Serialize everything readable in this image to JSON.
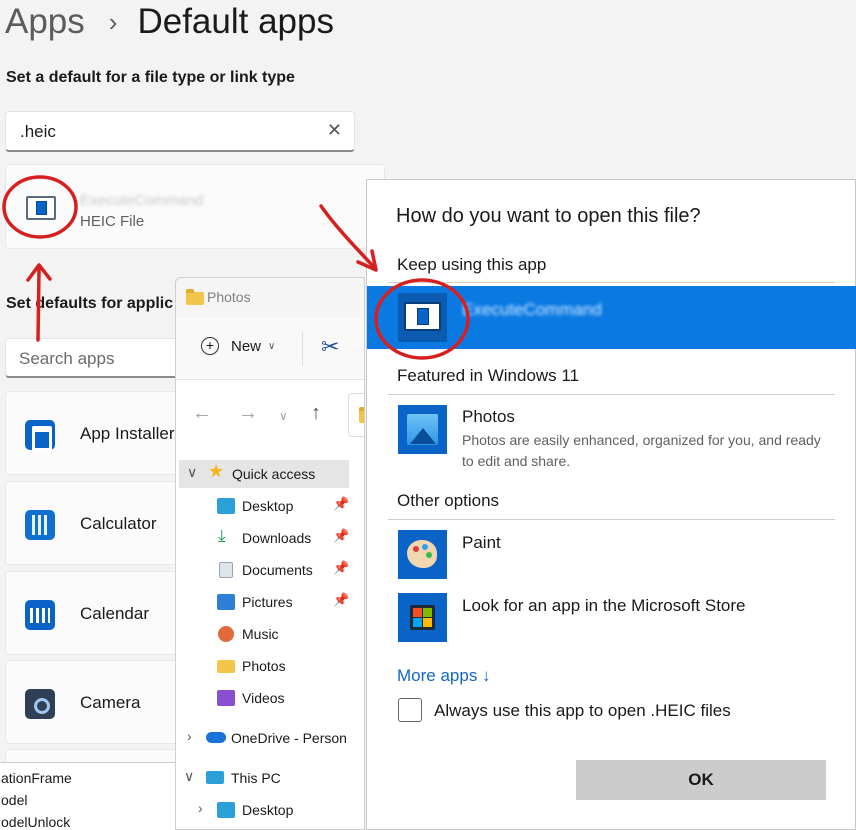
{
  "settings": {
    "breadcrumb": {
      "parent": "Apps",
      "current": "Default apps"
    },
    "filetype_heading": "Set a default for a file type or link type",
    "filetype_search": {
      "value": ".heic",
      "clear_icon": "close-icon"
    },
    "result": {
      "app_name": "ExecuteCommand",
      "file_type": "HEIC File"
    },
    "apps_heading": "Set defaults for applic",
    "app_search_placeholder": "Search apps",
    "apps": [
      {
        "label": "App Installer",
        "icon": "app-installer-icon"
      },
      {
        "label": "Calculator",
        "icon": "calculator-icon"
      },
      {
        "label": "Calendar",
        "icon": "calendar-icon"
      },
      {
        "label": "Camera",
        "icon": "camera-icon"
      }
    ],
    "bottom_lines": [
      "ationFrame",
      "odel",
      "odelUnlock"
    ]
  },
  "explorer": {
    "title": "Photos",
    "new_label": "New",
    "quick_access": [
      {
        "label": "Quick access",
        "icon": "star-icon"
      },
      {
        "label": "Desktop",
        "icon": "desktop-icon",
        "pinned": true
      },
      {
        "label": "Downloads",
        "icon": "download-icon",
        "pinned": true
      },
      {
        "label": "Documents",
        "icon": "documents-icon",
        "pinned": true
      },
      {
        "label": "Pictures",
        "icon": "pictures-icon",
        "pinned": true
      },
      {
        "label": "Music",
        "icon": "music-icon"
      },
      {
        "label": "Photos",
        "icon": "folder-icon"
      },
      {
        "label": "Videos",
        "icon": "videos-icon"
      }
    ],
    "onedrive": "OneDrive - Person",
    "this_pc": "This PC",
    "this_pc_child": "Desktop"
  },
  "dialog": {
    "title": "How do you want to open this file?",
    "keep_using": "Keep using this app",
    "current_app": "ExecuteCommand",
    "featured_heading": "Featured in Windows 11",
    "featured": {
      "name": "Photos",
      "description": "Photos are easily enhanced, organized for you, and ready to edit and share."
    },
    "other_heading": "Other options",
    "other": [
      {
        "name": "Paint"
      },
      {
        "name": "Look for an app in the Microsoft Store"
      }
    ],
    "more_apps": "More apps ↓",
    "always_use": "Always use this app to open .HEIC files",
    "always_use_checked": false,
    "ok_label": "OK"
  },
  "annotation_color": "#d62020"
}
